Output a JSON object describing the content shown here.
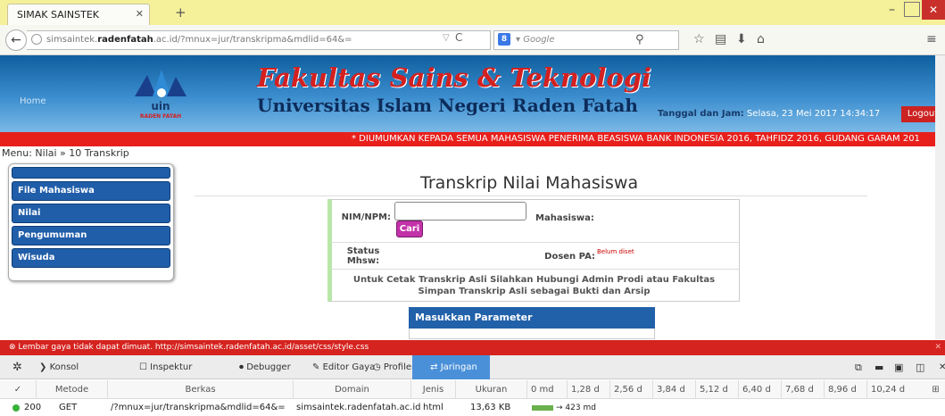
{
  "browser": {
    "tab_title": "SIMAK SAINSTEK",
    "url_prefix": "simsaintek.",
    "url_host": "radenfatah",
    "url_rest": ".ac.id/?mnux=jur/transkripma&mdlid=64&=",
    "search_placeholder": "Google",
    "search_engine_letter": "8"
  },
  "header": {
    "home": "Home",
    "logo_text": "uin",
    "logo_sub": "RADEN FATAH",
    "title": "Fakultas Sains & Teknologi",
    "subtitle": "Universitas Islam Negeri Raden Fatah",
    "tanggal_label": "Tanggal dan Jam:",
    "tanggal_value": " Selasa, 23 Mei 2017 14:34:17",
    "logout": "Logout"
  },
  "marquee": "* DIUMUMKAN KEPADA SEMUA MAHASISWA PENERIMA BEASISWA BANK INDONESIA 2016, TAHFIDZ 2016, GUDANG GARAM 201",
  "menu_path": "Menu: Nilai » 10 Transkrip",
  "sidebar": {
    "items": [
      "",
      "File Mahasiswa",
      "Nilai",
      "Pengumuman",
      "Wisuda"
    ]
  },
  "main": {
    "title": "Transkrip Nilai Mahasiswa",
    "nim_label": "NIM/NPM:",
    "cari": "Cari",
    "mahasiswa_label": "Mahasiswa:",
    "status_label": "Status Mhsw:",
    "dosen_label": "Dosen PA:",
    "dosen_value": "Belum diset",
    "note1": "Untuk Cetak Transkrip Asli Silahkan Hubungi Admin Prodi atau Fakultas",
    "note2": "Simpan Transkrip Asli sebagai Bukti dan Arsip",
    "param": "Masukkan Parameter"
  },
  "devtools": {
    "error": "Lembar gaya tidak dapat dimuat. http://simsaintek.radenfatah.ac.id/asset/css/style.css",
    "tabs": [
      "Konsol",
      "Inspektur",
      "Debugger",
      "Editor Gaya",
      "Profiler",
      "Jaringan"
    ],
    "columns": [
      "Metode",
      "Berkas",
      "Domain",
      "Jenis",
      "Ukuran",
      "0 md",
      "1,28 d",
      "2,56 d",
      "3,84 d",
      "5,12 d",
      "6,40 d",
      "7,68 d",
      "8,96 d",
      "10,24 d"
    ],
    "row": {
      "status": "200",
      "method": "GET",
      "file": "/?mnux=jur/transkripma&mdlid=64&=",
      "domain": "simsaintek.radenfatah.ac.id",
      "type": "html",
      "size": "13,63 KB",
      "time": "→ 423 md"
    }
  }
}
